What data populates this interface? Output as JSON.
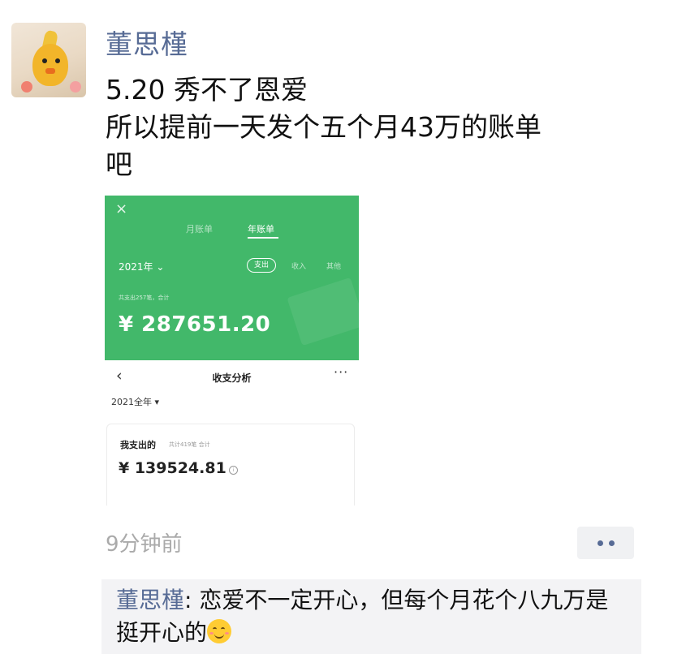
{
  "post": {
    "author": "董思槿",
    "text_lines": [
      "5.20 秀不了恩爱",
      "所以提前一天发个五个月43万的账单",
      "吧"
    ],
    "timestamp": "9分钟前"
  },
  "embedded_screenshot": {
    "top_panel": {
      "close": "×",
      "tab_month": "月账单",
      "tab_year": "年账单",
      "year_selector": "2021年 ⌄",
      "filter_expense": "支出",
      "filter_income": "收入",
      "filter_other": "其他",
      "summary": "共支出257笔，合计",
      "amount": "¥ 287651.20",
      "accent_color": "#42b86a"
    },
    "bottom_panel": {
      "back": "‹",
      "title": "收支分析",
      "more": "···",
      "year_selector": "2021全年 ▾",
      "card_label": "我支出的",
      "card_sub": "共计419笔 合计",
      "card_amount": "¥ 139524.81",
      "info_icon": "info-icon"
    }
  },
  "comment": {
    "author": "董思槿",
    "separator": ": ",
    "text": "恋爱不一定开心，但每个月花个八九万是挺开心的",
    "emoji": "smile-emoji"
  },
  "colors": {
    "name_blue": "#576b95",
    "timestamp_gray": "#aaaaaa",
    "comment_bg": "#f3f3f5"
  }
}
